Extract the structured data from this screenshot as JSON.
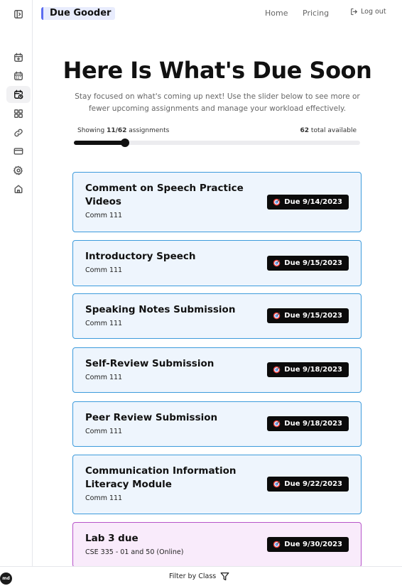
{
  "header": {
    "brand": "Due Gooder",
    "nav_home": "Home",
    "nav_pricing": "Pricing",
    "logout": "Log out"
  },
  "sidebar": {
    "items": [
      {
        "icon": "calendar-plus-icon"
      },
      {
        "icon": "calendar-icon"
      },
      {
        "icon": "calendar-clock-icon",
        "active": true
      },
      {
        "icon": "grid-icon"
      },
      {
        "icon": "link-icon"
      },
      {
        "icon": "credit-card-icon"
      },
      {
        "icon": "gear-icon"
      },
      {
        "icon": "home-icon"
      }
    ]
  },
  "hero": {
    "title": "Here Is What's Due Soon",
    "subtitle": "Stay focused on what's coming up next! Use the slider below to see more or fewer upcoming assignments and manage your workload effectively."
  },
  "slider": {
    "showing_prefix": "Showing ",
    "showing_count": "11/62",
    "showing_suffix": " assignments",
    "total_count": "62",
    "total_suffix": " total available",
    "shown": 11,
    "total": 62
  },
  "assignments": [
    {
      "title": "Comment on Speech Practice Videos",
      "course": "Comm 111",
      "due": "Due 9/14/2023"
    },
    {
      "title": "Introductory Speech",
      "course": "Comm 111",
      "due": "Due 9/15/2023"
    },
    {
      "title": "Speaking Notes Submission",
      "course": "Comm 111",
      "due": "Due 9/15/2023"
    },
    {
      "title": "Self-Review Submission",
      "course": "Comm 111",
      "due": "Due 9/18/2023"
    },
    {
      "title": "Peer Review Submission",
      "course": "Comm 111",
      "due": "Due 9/18/2023"
    },
    {
      "title": "Communication Information Literacy Module",
      "course": "Comm 111",
      "due": "Due 9/22/2023"
    },
    {
      "title": "Lab 3 due",
      "course": "CSE 335 - 01 and 50 (Online)",
      "due": "Due 9/30/2023"
    }
  ],
  "colors": {
    "card_bg": "#eef5fd",
    "card_border": "#3d9bdc",
    "lab_card_bg": "#f9ebfb",
    "lab_card_border": "#b654c9",
    "brand_accent": "#5b6cf0"
  },
  "bottom": {
    "avatar": "md",
    "filter_label": "Filter by Class"
  }
}
